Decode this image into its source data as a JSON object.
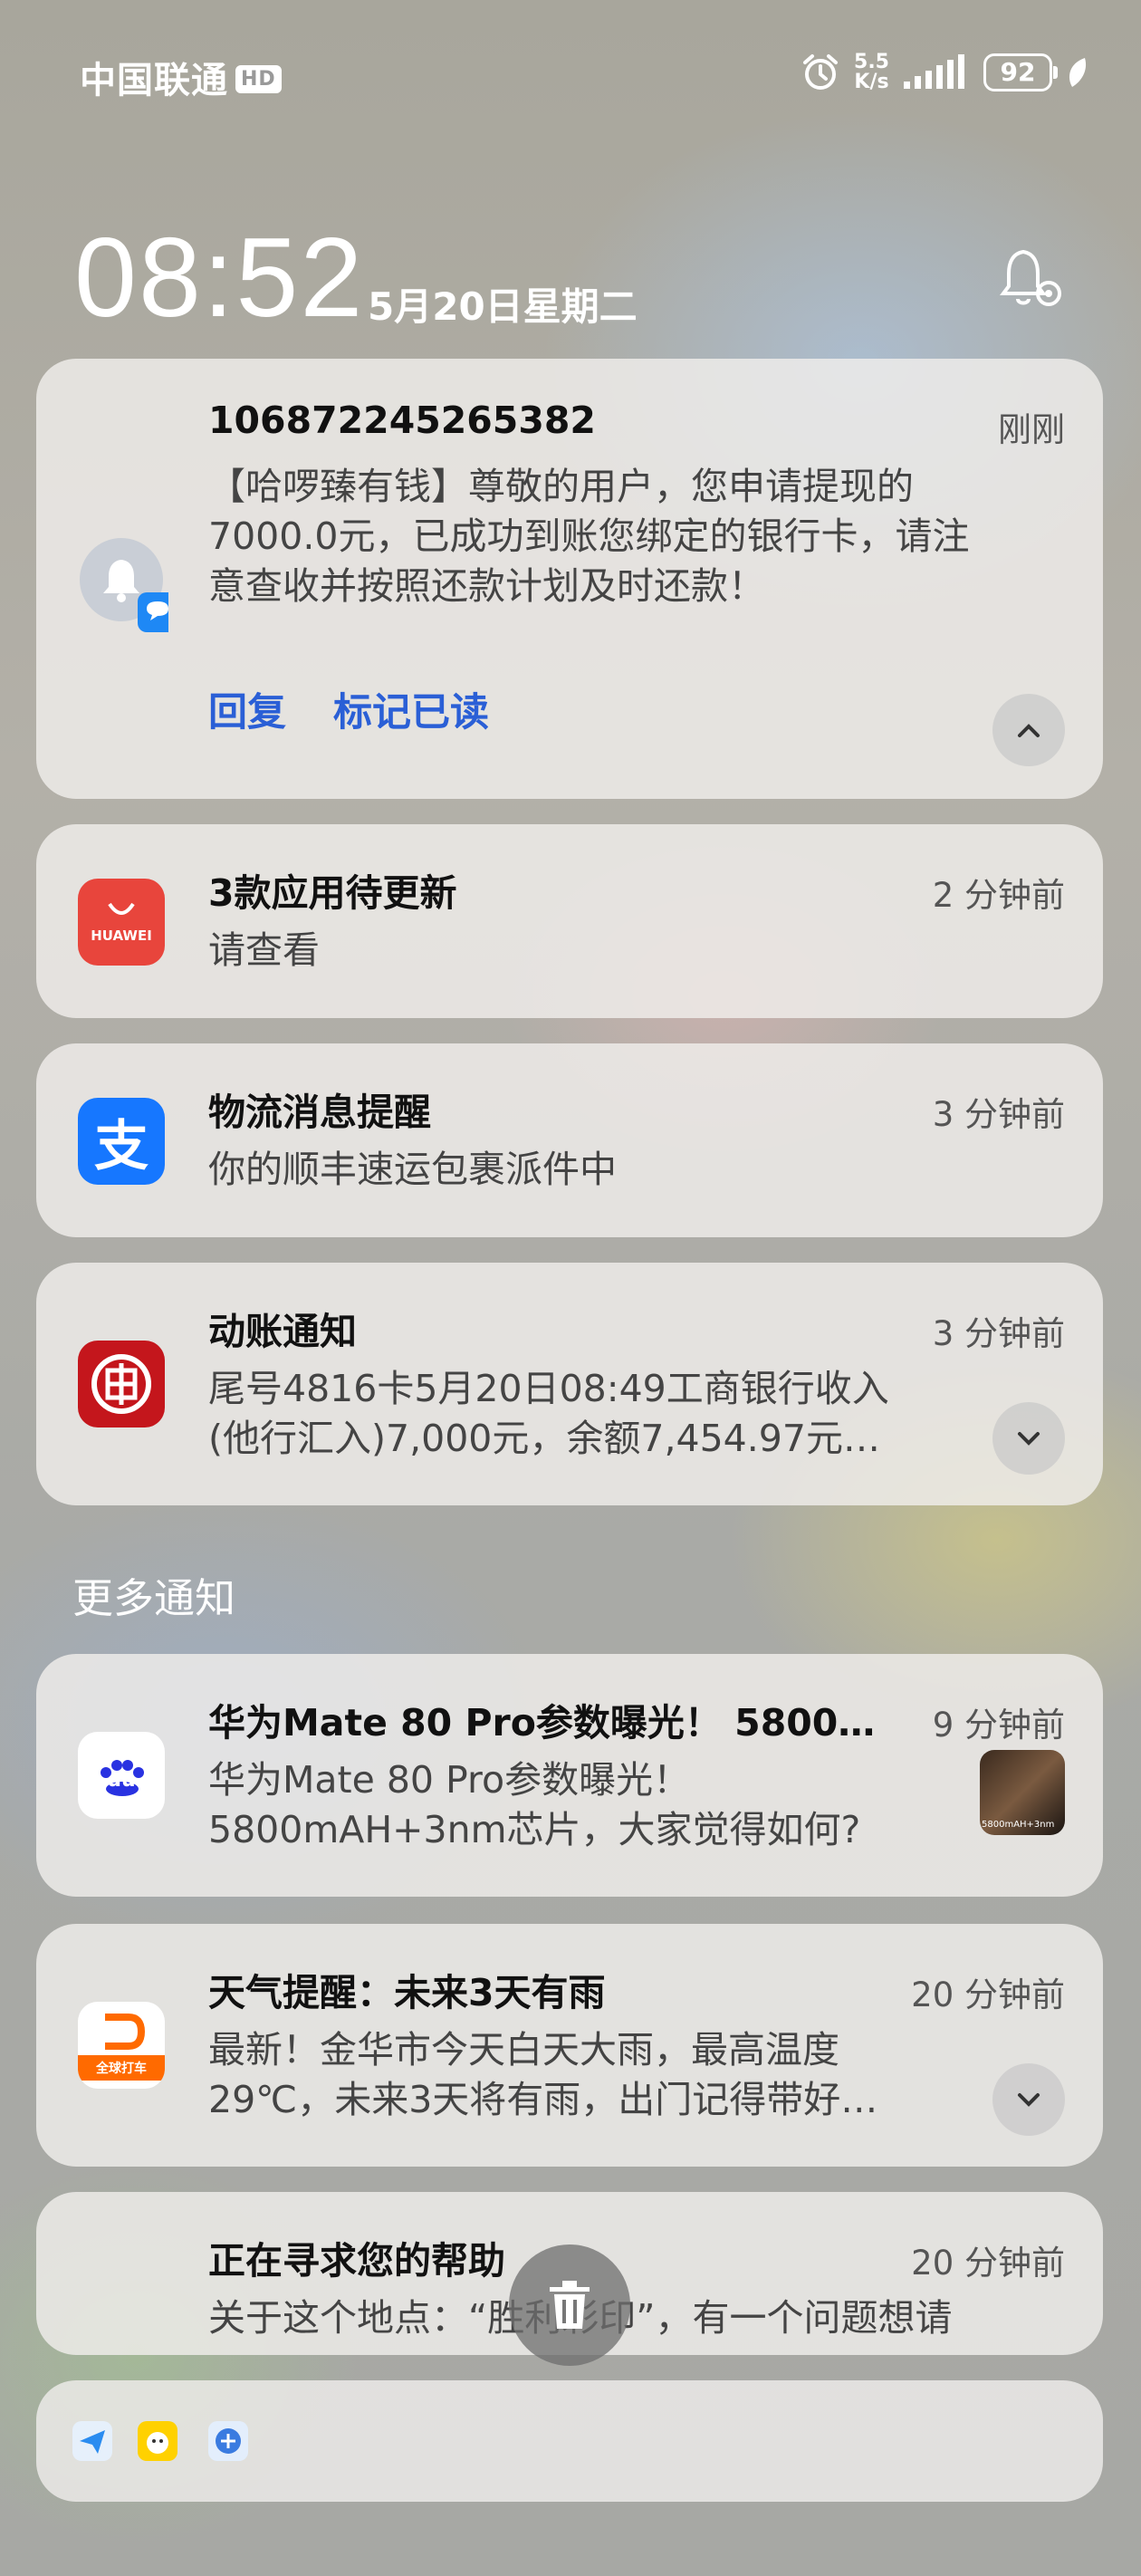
{
  "status_bar": {
    "carrier": "中国联通",
    "carrier_badge": "HD",
    "net_speed_value": "5.5",
    "net_speed_unit": "K/s",
    "battery": "92",
    "icons": [
      "alarm-icon",
      "signal-icon",
      "battery-icon",
      "leaf-icon"
    ]
  },
  "lock": {
    "time": "08:52",
    "date": "5月20日星期二"
  },
  "notifications": [
    {
      "app_icon": "messages-icon",
      "title": "106872245265382",
      "time": "刚刚",
      "body_lines": [
        "【哈啰臻有钱】尊敬的用户，您申请提现的",
        "7000.0元，已成功到账您绑定的银行卡，请注",
        "意查收并按照还款计划及时还款！"
      ],
      "actions": [
        "回复",
        "标记已读"
      ]
    },
    {
      "app_icon": "huawei-appgallery-icon",
      "app_icon_label": "HUAWEI",
      "title": "3款应用待更新",
      "time": "2 分钟前",
      "body": "请查看"
    },
    {
      "app_icon": "alipay-icon",
      "app_icon_label": "支",
      "title": "物流消息提醒",
      "time": "3 分钟前",
      "body": "你的顺丰速运包裹派件中"
    },
    {
      "app_icon": "icbc-icon",
      "title": "动账通知",
      "time": "3 分钟前",
      "body_lines": [
        "尾号4816卡5月20日08:49工商银行收入",
        "(他行汇入)7,000元，余额7,454.97元…"
      ]
    }
  ],
  "more_label": "更多通知",
  "more_notifications": [
    {
      "app_icon": "baidu-icon",
      "app_icon_label": "du",
      "title": "华为Mate 80 Pro参数曝光！ 5800…",
      "time": "9 分钟前",
      "body_lines": [
        "华为Mate 80 Pro参数曝光！",
        "5800mAH+3nm芯片，大家觉得如何?"
      ],
      "thumbnail_caption": "5800mAH+3nm"
    },
    {
      "app_icon": "didi-icon",
      "app_icon_label": "全球打车",
      "title": "天气提醒：未来3天有雨",
      "time": "20 分钟前",
      "body_lines": [
        "最新！金华市今天白天大雨，最高温度",
        "29℃，未来3天将有雨，出门记得带好…"
      ]
    },
    {
      "app_icon": "map-icon",
      "title": "正在寻求您的帮助",
      "time": "20 分钟前",
      "body": "关于这个地点：“胜利彩印”，有一个问题想请"
    }
  ],
  "dock_icons": [
    "send-app-icon",
    "meituan-app-icon",
    "browser-app-icon"
  ],
  "colors": {
    "accent_blue": "#2a5fd6",
    "huawei_red": "#e8453c",
    "alipay_blue": "#1677ff",
    "icbc_red": "#c4161c",
    "didi_orange": "#ff6a00"
  }
}
